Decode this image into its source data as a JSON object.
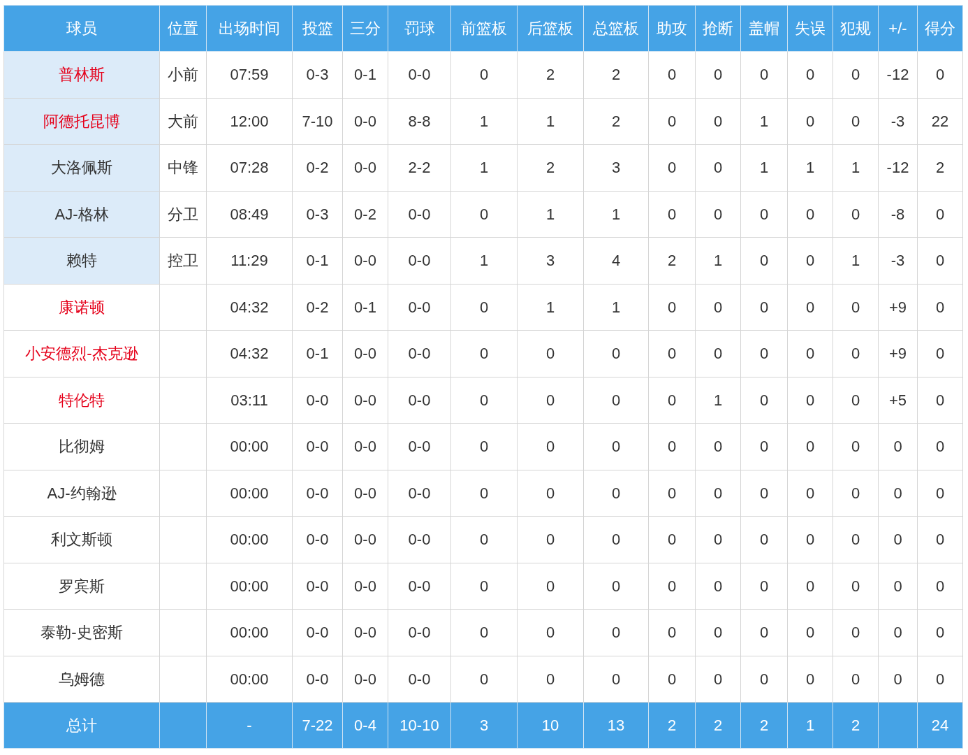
{
  "columns": [
    "球员",
    "位置",
    "出场时间",
    "投篮",
    "三分",
    "罚球",
    "前篮板",
    "后篮板",
    "总篮板",
    "助攻",
    "抢断",
    "盖帽",
    "失误",
    "犯规",
    "+/-",
    "得分"
  ],
  "rows": [
    {
      "name": "普林斯",
      "highlighted": true,
      "starter": true,
      "position": "小前",
      "stats": [
        "07:59",
        "0-3",
        "0-1",
        "0-0",
        "0",
        "2",
        "2",
        "0",
        "0",
        "0",
        "0",
        "0",
        "-12",
        "0"
      ]
    },
    {
      "name": "阿德托昆博",
      "highlighted": true,
      "starter": true,
      "position": "大前",
      "stats": [
        "12:00",
        "7-10",
        "0-0",
        "8-8",
        "1",
        "1",
        "2",
        "0",
        "0",
        "1",
        "0",
        "0",
        "-3",
        "22"
      ]
    },
    {
      "name": "大洛佩斯",
      "highlighted": false,
      "starter": true,
      "position": "中锋",
      "stats": [
        "07:28",
        "0-2",
        "0-0",
        "2-2",
        "1",
        "2",
        "3",
        "0",
        "0",
        "1",
        "1",
        "1",
        "-12",
        "2"
      ]
    },
    {
      "name": "AJ-格林",
      "highlighted": false,
      "starter": true,
      "position": "分卫",
      "stats": [
        "08:49",
        "0-3",
        "0-2",
        "0-0",
        "0",
        "1",
        "1",
        "0",
        "0",
        "0",
        "0",
        "0",
        "-8",
        "0"
      ]
    },
    {
      "name": "赖特",
      "highlighted": false,
      "starter": true,
      "position": "控卫",
      "stats": [
        "11:29",
        "0-1",
        "0-0",
        "0-0",
        "1",
        "3",
        "4",
        "2",
        "1",
        "0",
        "0",
        "1",
        "-3",
        "0"
      ]
    },
    {
      "name": "康诺顿",
      "highlighted": true,
      "starter": false,
      "stats": [
        "04:32",
        "0-2",
        "0-1",
        "0-0",
        "0",
        "1",
        "1",
        "0",
        "0",
        "0",
        "0",
        "0",
        "+9",
        "0"
      ]
    },
    {
      "name": "小安德烈-杰克逊",
      "highlighted": true,
      "starter": false,
      "stats": [
        "04:32",
        "0-1",
        "0-0",
        "0-0",
        "0",
        "0",
        "0",
        "0",
        "0",
        "0",
        "0",
        "0",
        "+9",
        "0"
      ]
    },
    {
      "name": "特伦特",
      "highlighted": true,
      "starter": false,
      "stats": [
        "03:11",
        "0-0",
        "0-0",
        "0-0",
        "0",
        "0",
        "0",
        "0",
        "1",
        "0",
        "0",
        "0",
        "+5",
        "0"
      ]
    },
    {
      "name": "比彻姆",
      "highlighted": false,
      "starter": false,
      "stats": [
        "00:00",
        "0-0",
        "0-0",
        "0-0",
        "0",
        "0",
        "0",
        "0",
        "0",
        "0",
        "0",
        "0",
        "0",
        "0"
      ]
    },
    {
      "name": "AJ-约翰逊",
      "highlighted": false,
      "starter": false,
      "stats": [
        "00:00",
        "0-0",
        "0-0",
        "0-0",
        "0",
        "0",
        "0",
        "0",
        "0",
        "0",
        "0",
        "0",
        "0",
        "0"
      ]
    },
    {
      "name": "利文斯顿",
      "highlighted": false,
      "starter": false,
      "stats": [
        "00:00",
        "0-0",
        "0-0",
        "0-0",
        "0",
        "0",
        "0",
        "0",
        "0",
        "0",
        "0",
        "0",
        "0",
        "0"
      ]
    },
    {
      "name": "罗宾斯",
      "highlighted": false,
      "starter": false,
      "stats": [
        "00:00",
        "0-0",
        "0-0",
        "0-0",
        "0",
        "0",
        "0",
        "0",
        "0",
        "0",
        "0",
        "0",
        "0",
        "0"
      ]
    },
    {
      "name": "泰勒-史密斯",
      "highlighted": false,
      "starter": false,
      "stats": [
        "00:00",
        "0-0",
        "0-0",
        "0-0",
        "0",
        "0",
        "0",
        "0",
        "0",
        "0",
        "0",
        "0",
        "0",
        "0"
      ]
    },
    {
      "name": "乌姆德",
      "highlighted": false,
      "starter": false,
      "stats": [
        "00:00",
        "0-0",
        "0-0",
        "0-0",
        "0",
        "0",
        "0",
        "0",
        "0",
        "0",
        "0",
        "0",
        "0",
        "0"
      ]
    }
  ],
  "totals": {
    "label": "总计",
    "stats": [
      "-",
      "7-22",
      "0-4",
      "10-10",
      "3",
      "10",
      "13",
      "2",
      "2",
      "2",
      "1",
      "2"
    ],
    "points": "24"
  }
}
